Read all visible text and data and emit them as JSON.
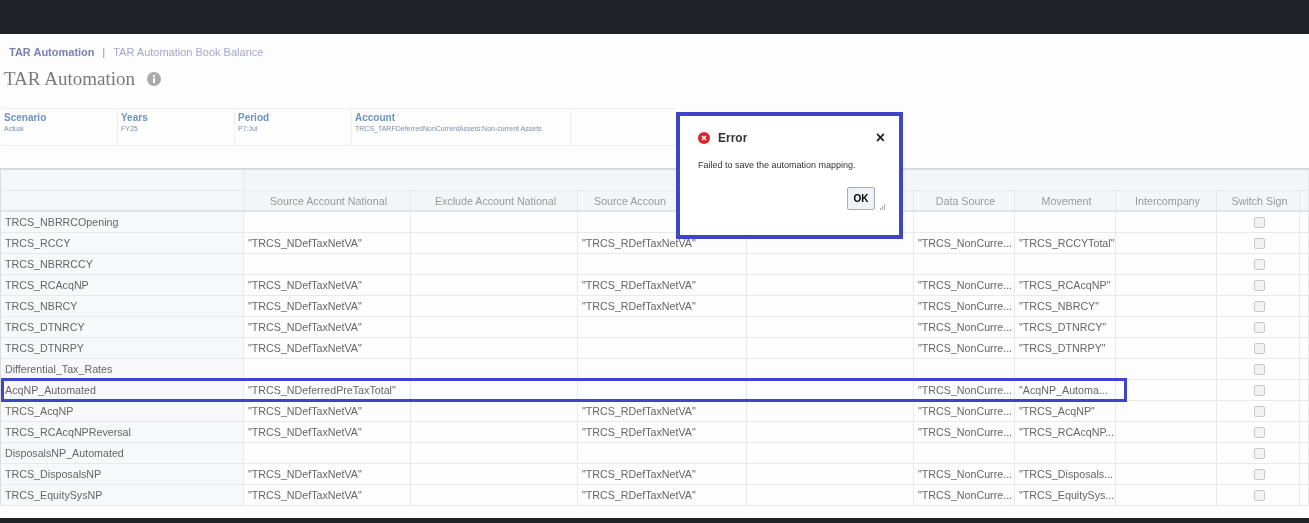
{
  "breadcrumbs": [
    {
      "label": "TAR Automation",
      "selected": true
    },
    {
      "label": "TAR Automation Book Balance",
      "selected": false
    }
  ],
  "breadcrumb_separator": "|",
  "page_title": "TAR Automation",
  "filters": [
    {
      "label": "Scenario",
      "value": "Actual"
    },
    {
      "label": "Years",
      "value": "FY25"
    },
    {
      "label": "Period",
      "value": "P7:Jul"
    },
    {
      "label": "Account",
      "value": "TRCS_TARFDeferredNonCurrentAssets:Non-current Assets"
    }
  ],
  "table": {
    "columns": [
      "Source Account National",
      "Exclude Account National",
      "Source Accoun",
      "",
      "Data Source",
      "Movement",
      "Intercompany",
      "Switch Sign"
    ],
    "rows": [
      {
        "name": "TRCS_NBRRCOpening",
        "cells": [
          "",
          "",
          "",
          "",
          "",
          "",
          ""
        ],
        "switch_sign": false,
        "highlighted": false
      },
      {
        "name": "TRCS_RCCY",
        "cells": [
          "\"TRCS_NDefTaxNetVA\"",
          "",
          "\"TRCS_RDefTaxNetVA\"",
          "",
          "\"TRCS_NonCurre...",
          "\"TRCS_RCCYTotal\"",
          ""
        ],
        "switch_sign": false,
        "highlighted": false
      },
      {
        "name": "TRCS_NBRRCCY",
        "cells": [
          "",
          "",
          "",
          "",
          "",
          "",
          ""
        ],
        "switch_sign": false,
        "highlighted": false
      },
      {
        "name": "TRCS_RCAcqNP",
        "cells": [
          "\"TRCS_NDefTaxNetVA\"",
          "",
          "\"TRCS_RDefTaxNetVA\"",
          "",
          "\"TRCS_NonCurre...",
          "\"TRCS_RCAcqNP\"",
          ""
        ],
        "switch_sign": false,
        "highlighted": false
      },
      {
        "name": "TRCS_NBRCY",
        "cells": [
          "\"TRCS_NDefTaxNetVA\"",
          "",
          "\"TRCS_RDefTaxNetVA\"",
          "",
          "\"TRCS_NonCurre...",
          "\"TRCS_NBRCY\"",
          ""
        ],
        "switch_sign": false,
        "highlighted": false
      },
      {
        "name": "TRCS_DTNRCY",
        "cells": [
          "\"TRCS_NDefTaxNetVA\"",
          "",
          "",
          "",
          "\"TRCS_NonCurre...",
          "\"TRCS_DTNRCY\"",
          ""
        ],
        "switch_sign": false,
        "highlighted": false
      },
      {
        "name": "TRCS_DTNRPY",
        "cells": [
          "\"TRCS_NDefTaxNetVA\"",
          "",
          "",
          "",
          "\"TRCS_NonCurre...",
          "\"TRCS_DTNRPY\"",
          ""
        ],
        "switch_sign": false,
        "highlighted": false
      },
      {
        "name": "Differential_Tax_Rates",
        "cells": [
          "",
          "",
          "",
          "",
          "",
          "",
          ""
        ],
        "switch_sign": false,
        "highlighted": false
      },
      {
        "name": "AcqNP_Automated",
        "cells": [
          "\"TRCS_NDeferredPreTaxTotal\"",
          "",
          "",
          "",
          "\"TRCS_NonCurre...",
          "\"AcqNP_Automa...",
          ""
        ],
        "switch_sign": false,
        "highlighted": true
      },
      {
        "name": "TRCS_AcqNP",
        "cells": [
          "\"TRCS_NDefTaxNetVA\"",
          "",
          "\"TRCS_RDefTaxNetVA\"",
          "",
          "\"TRCS_NonCurre...",
          "\"TRCS_AcqNP\"",
          ""
        ],
        "switch_sign": false,
        "highlighted": false
      },
      {
        "name": "TRCS_RCAcqNPReversal",
        "cells": [
          "\"TRCS_NDefTaxNetVA\"",
          "",
          "\"TRCS_RDefTaxNetVA\"",
          "",
          "\"TRCS_NonCurre...",
          "\"TRCS_RCAcqNP...",
          ""
        ],
        "switch_sign": false,
        "highlighted": false
      },
      {
        "name": "DisposalsNP_Automated",
        "cells": [
          "",
          "",
          "",
          "",
          "",
          "",
          ""
        ],
        "switch_sign": false,
        "highlighted": false
      },
      {
        "name": "TRCS_DisposalsNP",
        "cells": [
          "\"TRCS_NDefTaxNetVA\"",
          "",
          "\"TRCS_RDefTaxNetVA\"",
          "",
          "\"TRCS_NonCurre...",
          "\"TRCS_Disposals...",
          ""
        ],
        "switch_sign": false,
        "highlighted": false
      },
      {
        "name": "TRCS_EquitySysNP",
        "cells": [
          "\"TRCS_NDefTaxNetVA\"",
          "",
          "\"TRCS_RDefTaxNetVA\"",
          "",
          "\"TRCS_NonCurre...",
          "\"TRCS_EquitySys...",
          ""
        ],
        "switch_sign": false,
        "highlighted": false
      }
    ]
  },
  "dialog": {
    "title": "Error",
    "close": "×",
    "message": "Failed to save the automation mapping.",
    "button": "OK"
  }
}
